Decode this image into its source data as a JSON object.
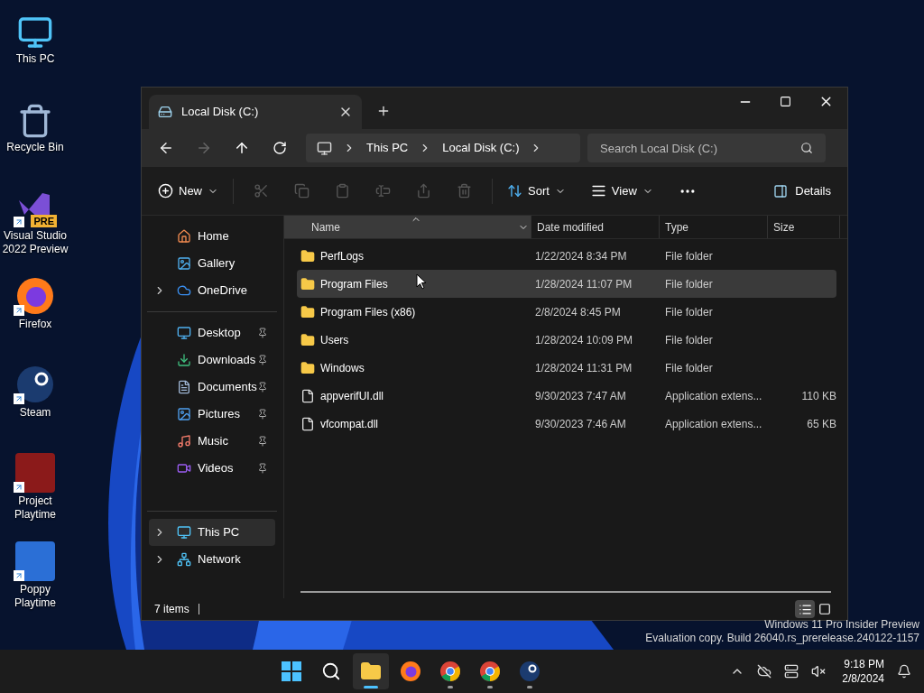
{
  "desktop_icons": [
    {
      "label": "This PC",
      "kind": "monitor",
      "shortcut": false
    },
    {
      "label": "Recycle Bin",
      "kind": "recycle-bin",
      "shortcut": false
    },
    {
      "label": "Visual Studio 2022 Preview",
      "kind": "visual-studio",
      "badge": "PRE",
      "shortcut": true
    },
    {
      "label": "Firefox",
      "kind": "firefox",
      "shortcut": true
    },
    {
      "label": "Steam",
      "kind": "steam",
      "shortcut": true
    },
    {
      "label": "Project Playtime",
      "kind": "game",
      "color": "#8b1a1a",
      "shortcut": true
    },
    {
      "label": "Poppy Playtime",
      "kind": "game",
      "color": "#2b6fd6",
      "shortcut": true
    }
  ],
  "window": {
    "tabs": [
      {
        "title": "Local Disk (C:)",
        "selected": true
      }
    ],
    "nav": {
      "back_disabled": false,
      "forward_disabled": true
    },
    "breadcrumb": [
      "This PC",
      "Local Disk (C:)"
    ],
    "search": {
      "placeholder": "Search Local Disk (C:)"
    },
    "toolbar": {
      "new": "New",
      "actions": [
        {
          "kind": "cut",
          "disabled": true
        },
        {
          "kind": "copy",
          "disabled": true
        },
        {
          "kind": "paste",
          "disabled": true
        },
        {
          "kind": "rename",
          "disabled": true
        },
        {
          "kind": "share",
          "disabled": true
        },
        {
          "kind": "delete",
          "disabled": true
        }
      ],
      "sort": "Sort",
      "view": "View",
      "details": "Details"
    },
    "sidebar": {
      "groups": [
        [
          {
            "label": "Home",
            "kind": "home",
            "expandable": false,
            "pinned": false,
            "selected": false
          },
          {
            "label": "Gallery",
            "kind": "gallery",
            "expandable": false,
            "pinned": false,
            "selected": false
          },
          {
            "label": "OneDrive",
            "kind": "cloud",
            "expandable": true,
            "pinned": false,
            "selected": false
          }
        ],
        [
          {
            "label": "Desktop",
            "kind": "desktop",
            "expandable": false,
            "pinned": true,
            "selected": false
          },
          {
            "label": "Downloads",
            "kind": "downloads",
            "expandable": false,
            "pinned": true,
            "selected": false
          },
          {
            "label": "Documents",
            "kind": "documents",
            "expandable": false,
            "pinned": true,
            "selected": false
          },
          {
            "label": "Pictures",
            "kind": "pictures",
            "expandable": false,
            "pinned": true,
            "selected": false
          },
          {
            "label": "Music",
            "kind": "music",
            "expandable": false,
            "pinned": true,
            "selected": false
          },
          {
            "label": "Videos",
            "kind": "videos",
            "expandable": false,
            "pinned": true,
            "selected": false
          }
        ],
        [
          {
            "label": "This PC",
            "kind": "pc",
            "expandable": true,
            "pinned": false,
            "selected": true
          },
          {
            "label": "Network",
            "kind": "network",
            "expandable": true,
            "pinned": false,
            "selected": false
          }
        ]
      ]
    },
    "table": {
      "columns": [
        {
          "label": "Name",
          "sorted": true
        },
        {
          "label": "Date modified",
          "sorted": false
        },
        {
          "label": "Type",
          "sorted": false
        },
        {
          "label": "Size",
          "sorted": false
        }
      ],
      "rows": [
        {
          "kind": "folder",
          "name": "PerfLogs",
          "date": "1/22/2024 8:34 PM",
          "type": "File folder",
          "selected": false
        },
        {
          "kind": "folder",
          "name": "Program Files",
          "date": "1/28/2024 11:07 PM",
          "type": "File folder",
          "selected": true
        },
        {
          "kind": "folder",
          "name": "Program Files (x86)",
          "date": "2/8/2024 8:45 PM",
          "type": "File folder",
          "selected": false
        },
        {
          "kind": "folder",
          "name": "Users",
          "date": "1/28/2024 10:09 PM",
          "type": "File folder",
          "selected": false
        },
        {
          "kind": "folder",
          "name": "Windows",
          "date": "1/28/2024 11:31 PM",
          "type": "File folder",
          "selected": false
        },
        {
          "kind": "file",
          "name": "appverifUI.dll",
          "date": "9/30/2023 7:47 AM",
          "type": "Application extens...",
          "size": "110 KB",
          "selected": false
        },
        {
          "kind": "file",
          "name": "vfcompat.dll",
          "date": "9/30/2023 7:46 AM",
          "type": "Application extens...",
          "size": "65 KB",
          "selected": false
        }
      ]
    },
    "status_bar": {
      "count": "7 items",
      "views": [
        {
          "kind": "details",
          "selected": true
        },
        {
          "kind": "tiles",
          "selected": false
        }
      ]
    }
  },
  "watermark_os": [
    "Windows 11 Pro Insider Preview",
    "Evaluation copy. Build 26040.rs_prerelease.240122-1157"
  ],
  "taskbar": {
    "apps": [
      {
        "kind": "start",
        "running": false,
        "active": false
      },
      {
        "kind": "search",
        "running": false,
        "active": false
      },
      {
        "kind": "explorer",
        "running": true,
        "active": true
      },
      {
        "kind": "firefox",
        "running": false,
        "active": false
      },
      {
        "kind": "chrome",
        "running": true,
        "active": false
      },
      {
        "kind": "chrome",
        "running": true,
        "active": false
      },
      {
        "kind": "steam",
        "running": true,
        "active": false
      }
    ],
    "time": "9:18 PM",
    "date": "2/8/2024"
  }
}
